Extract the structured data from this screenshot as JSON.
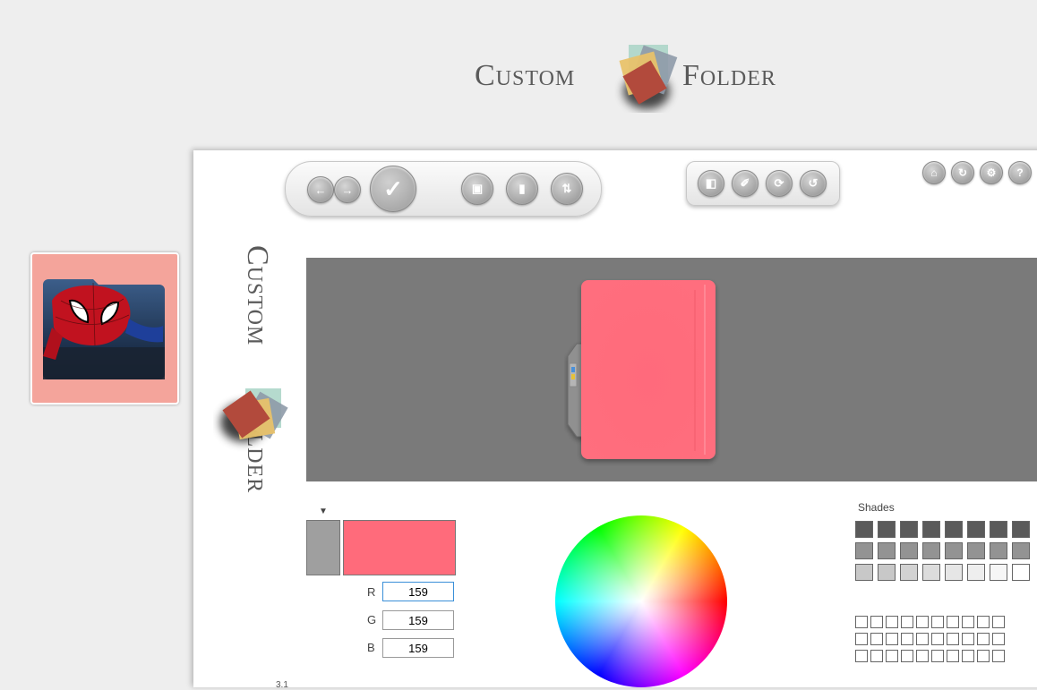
{
  "logo": {
    "word_left": "Custom",
    "word_right": "Folder",
    "version": "3.1"
  },
  "toolbar": {
    "back_icon": "arrow-left-icon",
    "forward_icon": "arrow-right-icon",
    "apply_icon": "checkmark-icon",
    "window_icon": "window-icon",
    "bookmark_icon": "bookmark-icon",
    "swap_icon": "swap-icon",
    "tools": [
      "folder-type-icon",
      "palette-icon",
      "rotate-icon",
      "undo-icon"
    ],
    "corner": [
      "home-icon",
      "refresh-icon",
      "gear-icon",
      "help-icon"
    ]
  },
  "preview": {
    "folder_color": "#ff6b7b",
    "background": "#7a7a7a"
  },
  "color_picker": {
    "previous_color": "#9f9f9f",
    "current_color": "#ff6b7b",
    "r_label": "R",
    "r_value": "159",
    "g_label": "G",
    "g_value": "159",
    "b_label": "B",
    "b_value": "159"
  },
  "shades": {
    "title": "Shades",
    "rows": [
      [
        "#5a5a5a",
        "#5a5a5a",
        "#5a5a5a",
        "#5a5a5a",
        "#5a5a5a",
        "#5a5a5a",
        "#5a5a5a",
        "#5a5a5a"
      ],
      [
        "#939393",
        "#939393",
        "#939393",
        "#939393",
        "#939393",
        "#939393",
        "#939393",
        "#939393"
      ],
      [
        "#c8c8c8",
        "#c8c8c8",
        "#d2d2d2",
        "#dcdcdc",
        "#e6e6e6",
        "#eeeeee",
        "#f6f6f6",
        "#ffffff"
      ]
    ],
    "custom_rows": 3,
    "custom_cols": 10
  }
}
